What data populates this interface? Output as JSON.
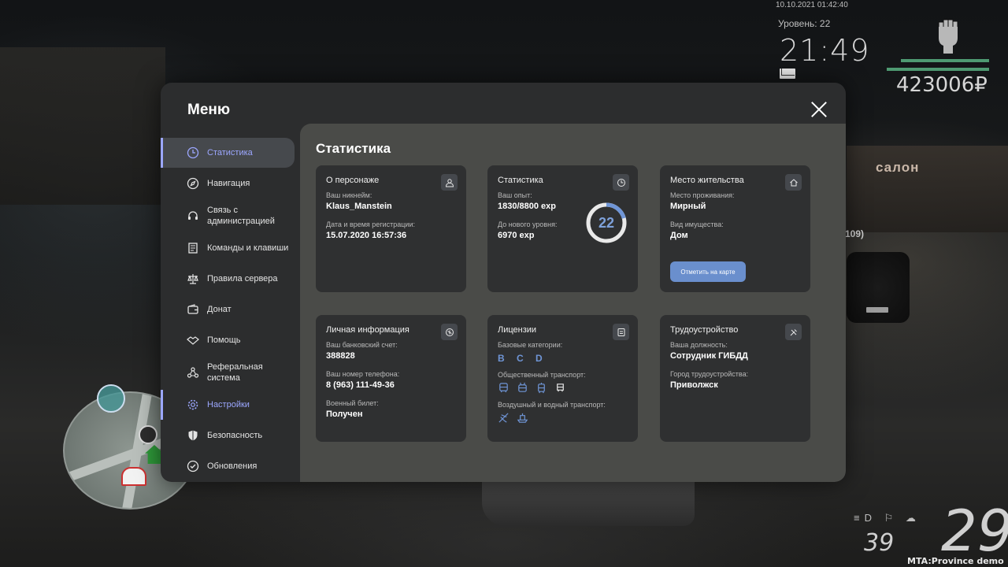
{
  "hud": {
    "datetime": "10.10.2021 01:42:40",
    "level": "Уровень: 22",
    "clock": "21:49",
    "money": "423006₽",
    "speed": "29",
    "fuel": "39",
    "background_sign": "салон",
    "background_label": "109)",
    "footer": "MTA:Province demo"
  },
  "modal": {
    "title": "Меню",
    "close_icon": "close-icon"
  },
  "sidebar": {
    "items": [
      {
        "label": "Статистика",
        "icon": "clock-icon",
        "state": "active"
      },
      {
        "label": "Навигация",
        "icon": "compass-icon"
      },
      {
        "label": "Связь с администрацией",
        "icon": "headset-icon"
      },
      {
        "label": "Команды и клавиши",
        "icon": "document-icon"
      },
      {
        "label": "Правила сервера",
        "icon": "scales-icon"
      },
      {
        "label": "Донат",
        "icon": "wallet-icon"
      },
      {
        "label": "Помощь",
        "icon": "handshake-icon"
      },
      {
        "label": "Реферальная система",
        "icon": "network-icon"
      },
      {
        "label": "Настройки",
        "icon": "gear-icon",
        "state": "hover"
      },
      {
        "label": "Безопасность",
        "icon": "shield-icon"
      },
      {
        "label": "Обновления",
        "icon": "check-circle-icon"
      }
    ]
  },
  "content": {
    "title": "Статистика",
    "accent": "#6f95d6",
    "cards": {
      "character": {
        "title": "О персонаже",
        "nickname_label": "Ваш никнейм:",
        "nickname": "Klaus_Manstein",
        "reg_label": "Дата и время регистрации:",
        "reg_value": "15.07.2020 16:57:36"
      },
      "stats": {
        "title": "Статистика",
        "exp_label": "Ваш опыт:",
        "exp_value": "1830/8800 exp",
        "next_label": "До нового уровня:",
        "next_value": "6970 exp",
        "level": "22",
        "progress": 0.208
      },
      "residence": {
        "title": "Место жительства",
        "place_label": "Место проживания:",
        "place_value": "Мирный",
        "property_label": "Вид имущества:",
        "property_value": "Дом",
        "map_button": "Отметить на карте"
      },
      "personal": {
        "title": "Личная информация",
        "bank_label": "Ваш банковский счет:",
        "bank_value": "388828",
        "phone_label": "Ваш номер телефона:",
        "phone_value": "8 (963) 111-49-36",
        "military_label": "Военный билет:",
        "military_value": "Получен"
      },
      "licenses": {
        "title": "Лицензии",
        "base_label": "Базовые категории:",
        "base_value": "B C D",
        "public_label": "Общественный транспорт:",
        "air_water_label": "Воздушный и водный транспорт:"
      },
      "employment": {
        "title": "Трудоустройство",
        "position_label": "Ваша должность:",
        "position_value": "Сотрудник ГИБДД",
        "city_label": "Город трудоустройства:",
        "city_value": "Приволжск"
      }
    }
  }
}
